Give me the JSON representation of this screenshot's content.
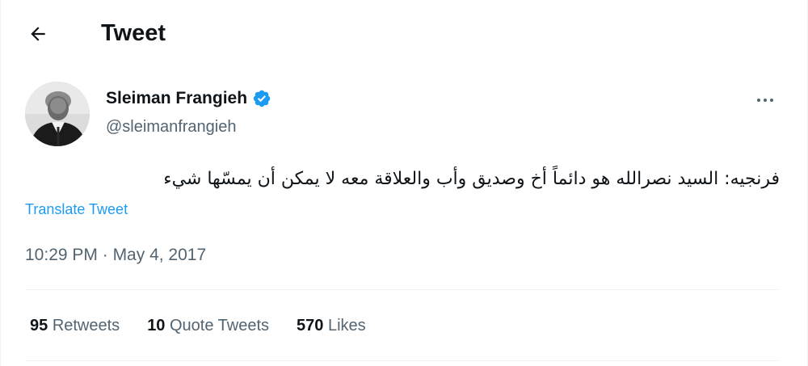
{
  "header": {
    "title": "Tweet",
    "back_icon": "arrow-left-icon"
  },
  "author": {
    "display_name": "Sleiman Frangieh",
    "handle": "@sleimanfrangieh",
    "verified": true,
    "verified_color": "#1d9bf0"
  },
  "tweet": {
    "text": "فرنجيه: السيد نصرالله هو دائماً أخ وصديق وأب والعلاقة معه لا يمكن أن يمسّها شيء",
    "translate_label": "Translate Tweet",
    "time": "10:29 PM",
    "separator": " · ",
    "date": "May 4, 2017"
  },
  "stats": [
    {
      "count": "95",
      "label": "Retweets"
    },
    {
      "count": "10",
      "label": "Quote Tweets"
    },
    {
      "count": "570",
      "label": "Likes"
    }
  ],
  "colors": {
    "accent": "#1d9bf0",
    "text_primary": "#0f1419",
    "text_secondary": "#536471",
    "divider": "#eff3f4"
  }
}
